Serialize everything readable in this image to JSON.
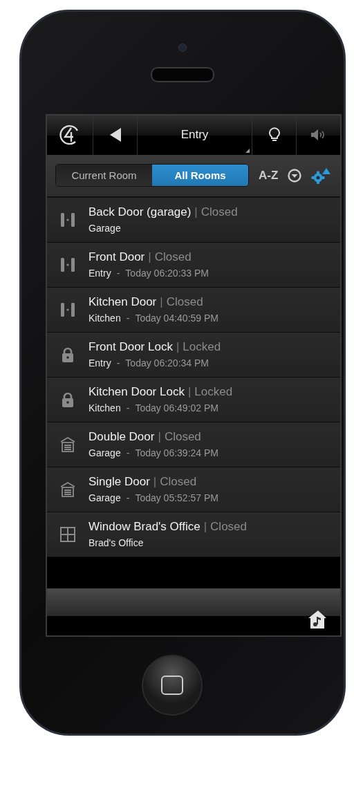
{
  "header": {
    "title": "Entry"
  },
  "toolbar": {
    "segments": [
      {
        "label": "Current Room",
        "selected": false
      },
      {
        "label": "All Rooms",
        "selected": true
      }
    ],
    "sort_label": "A-Z"
  },
  "devices": [
    {
      "kind": "door",
      "name": "Back Door (garage)",
      "divider": "|",
      "state": "Closed",
      "room": "Garage"
    },
    {
      "kind": "door",
      "name": "Front Door",
      "divider": "|",
      "state": "Closed",
      "room": "Entry",
      "separator": "-",
      "time": "Today 06:20:33 PM"
    },
    {
      "kind": "door",
      "name": "Kitchen Door",
      "divider": "|",
      "state": "Closed",
      "room": "Kitchen",
      "separator": "-",
      "time": "Today 04:40:59 PM"
    },
    {
      "kind": "lock",
      "name": "Front Door Lock",
      "divider": "|",
      "state": "Locked",
      "room": "Entry",
      "separator": "-",
      "time": "Today 06:20:34 PM"
    },
    {
      "kind": "lock",
      "name": "Kitchen Door Lock",
      "divider": "|",
      "state": "Locked",
      "room": "Kitchen",
      "separator": "-",
      "time": "Today 06:49:02 PM"
    },
    {
      "kind": "garage",
      "name": "Double Door",
      "divider": "|",
      "state": "Closed",
      "room": "Garage",
      "separator": "-",
      "time": "Today 06:39:24 PM"
    },
    {
      "kind": "garage",
      "name": "Single Door",
      "divider": "|",
      "state": "Closed",
      "room": "Garage",
      "separator": "-",
      "time": "Today 05:52:57 PM"
    },
    {
      "kind": "window",
      "name": "Window Brad's Office",
      "divider": "|",
      "state": "Closed",
      "room": "Brad's Office"
    }
  ]
}
